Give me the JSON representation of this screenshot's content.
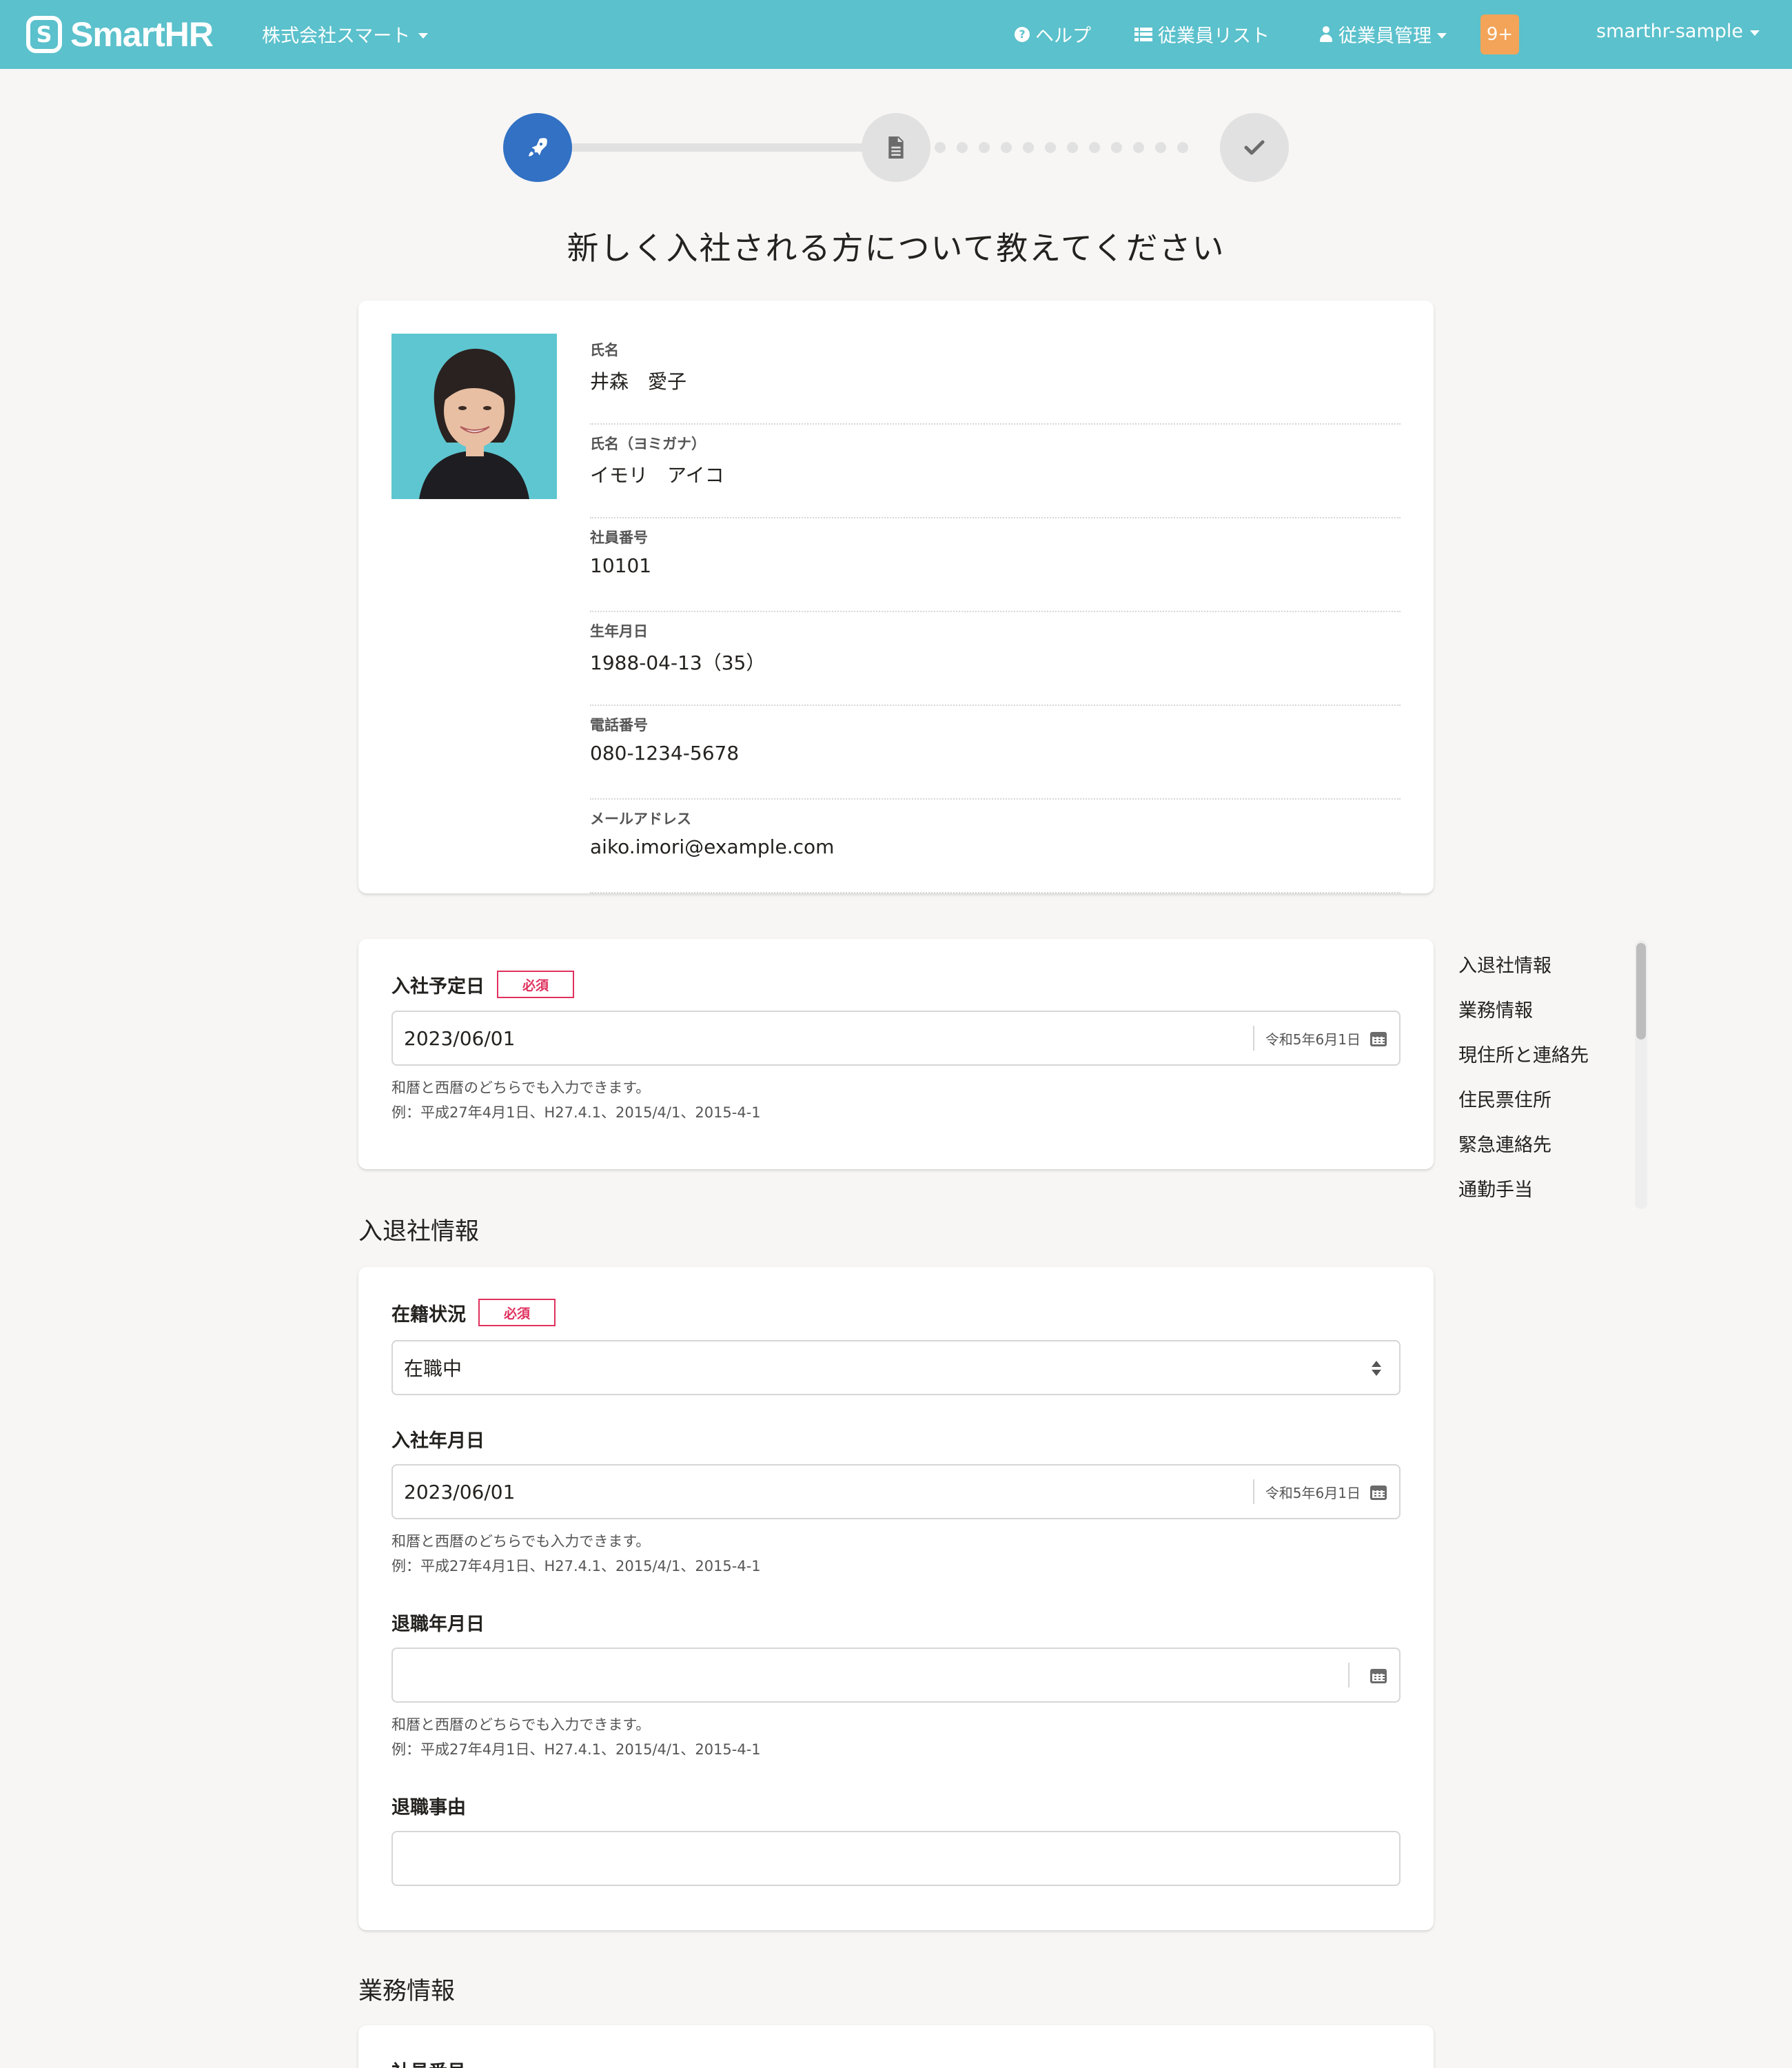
{
  "header": {
    "logo_mark": "S",
    "logo_text": "SmartHR",
    "company": "株式会社スマート",
    "help": "ヘルプ",
    "employee_list": "従業員リスト",
    "employee_manage": "従業員管理",
    "notifications": "9+",
    "user": "smarthr-sample",
    "colors": {
      "bar": "#5bc1cc",
      "badge": "#f3a458"
    }
  },
  "stepper": {
    "current_step": 1,
    "total_steps": 3,
    "colors": {
      "active": "#3271c4",
      "inactive": "#e1e1e1"
    }
  },
  "page_title": "新しく入社される方について教えてください",
  "profile": {
    "fields": [
      {
        "label": "氏名",
        "value": "井森　愛子"
      },
      {
        "label": "氏名（ヨミガナ）",
        "value": "イモリ　アイコ"
      },
      {
        "label": "社員番号",
        "value": "10101"
      },
      {
        "label": "生年月日",
        "value": "1988-04-13（35）"
      },
      {
        "label": "電話番号",
        "value": "080-1234-5678"
      },
      {
        "label": "メールアドレス",
        "value": "aiko.imori@example.com"
      }
    ]
  },
  "hire_date": {
    "label": "入社予定日",
    "required": "必須",
    "value": "2023/06/01",
    "wareki": "令和5年6月1日",
    "hint1": "和暦と西暦のどちらでも入力できます。",
    "hint2": "例：平成27年4月1日、H27.4.1、2015/4/1、2015-4-1"
  },
  "section_enrollment": {
    "heading": "入退社情報",
    "status": {
      "label": "在籍状況",
      "required": "必須",
      "value": "在職中"
    },
    "join_date": {
      "label": "入社年月日",
      "value": "2023/06/01",
      "wareki": "令和5年6月1日",
      "hint1": "和暦と西暦のどちらでも入力できます。",
      "hint2": "例：平成27年4月1日、H27.4.1、2015/4/1、2015-4-1"
    },
    "leave_date": {
      "label": "退職年月日",
      "value": "",
      "wareki": "",
      "hint1": "和暦と西暦のどちらでも入力できます。",
      "hint2": "例：平成27年4月1日、H27.4.1、2015/4/1、2015-4-1"
    },
    "leave_reason": {
      "label": "退職事由",
      "value": ""
    }
  },
  "section_work": {
    "heading": "業務情報",
    "first_field_label": "社員番号"
  },
  "side_nav": [
    "入退社情報",
    "業務情報",
    "現住所と連絡先",
    "住民票住所",
    "緊急連絡先",
    "通勤手当"
  ]
}
